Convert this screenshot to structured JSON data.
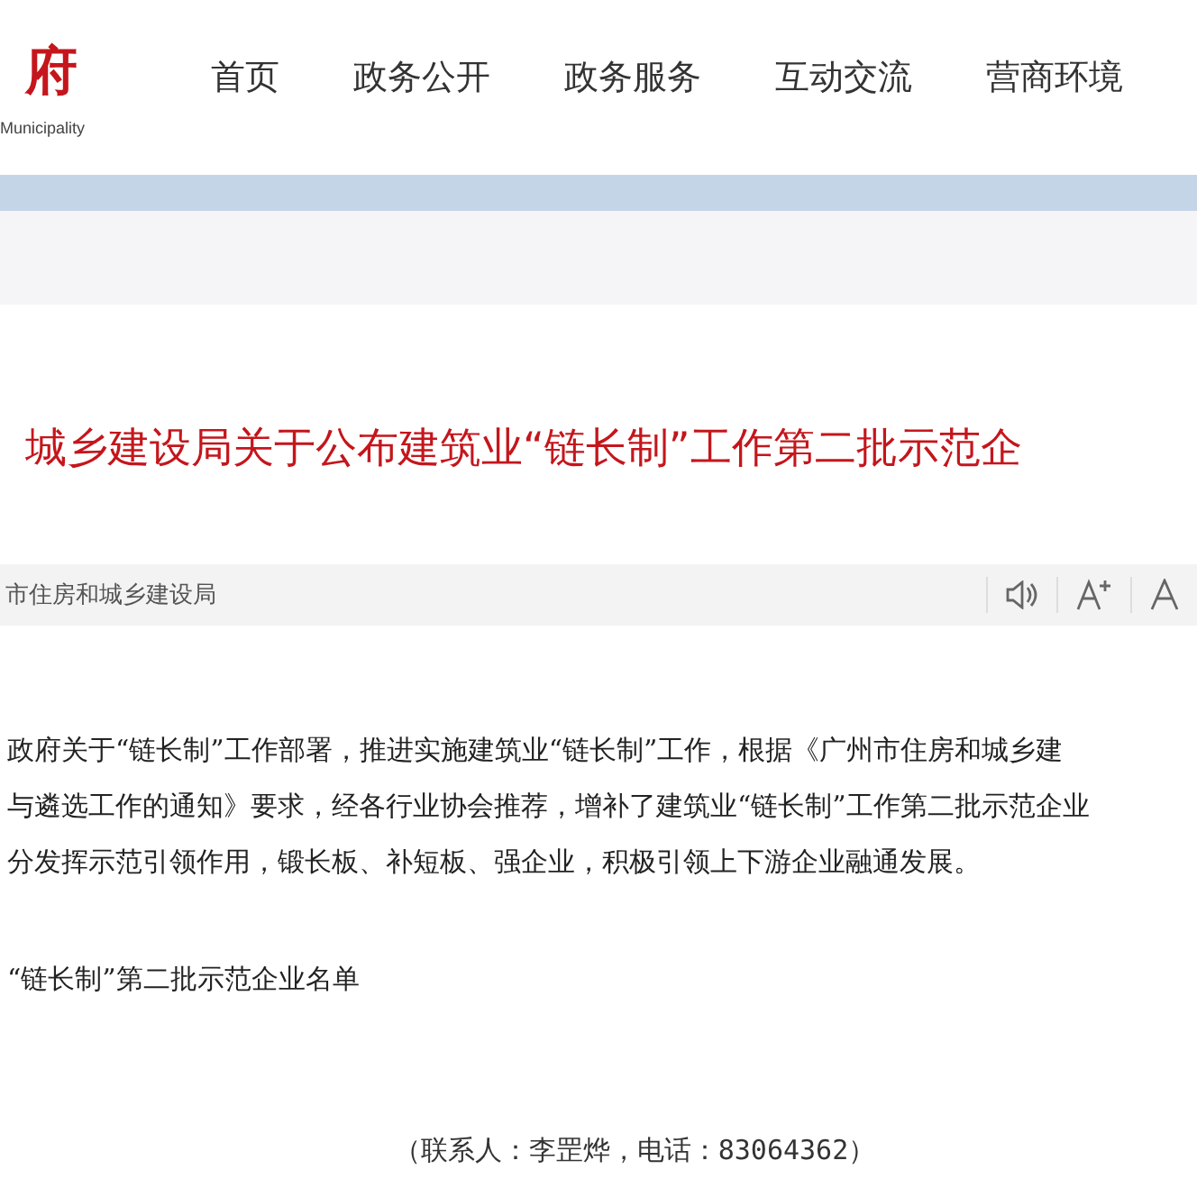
{
  "header": {
    "logo_text": "府",
    "logo_subtitle": "Municipality",
    "nav": [
      {
        "label": "首页",
        "selected": false
      },
      {
        "label": "政务公开",
        "selected": false
      },
      {
        "label": "政务服务",
        "selected": false
      },
      {
        "label": "互动交流",
        "selected": false
      },
      {
        "label": "营商环境",
        "selected": false
      }
    ]
  },
  "article": {
    "title": "城乡建设局关于公布建筑业“链长制”工作第二批示范企",
    "source": "市住房和城乡建设局",
    "tools": [
      {
        "kind": "speaker"
      },
      {
        "kind": "font-larger"
      },
      {
        "kind": "font-normal"
      }
    ],
    "body_lines": [
      "政府关于“链长制”工作部署，推进实施建筑业“链长制”工作，根据《广州市住房和城乡建",
      "与遴选工作的通知》要求，经各行业协会推荐，增补了建筑业“链长制”工作第二批示范企业",
      "分发挥示范引领作用，锻长板、补短板、强企业，积极引领上下游企业融通发展。"
    ],
    "attachment": "“链长制”第二批示范企业名单",
    "contact": "（联系人：李罡烨，电话：83064362）"
  }
}
